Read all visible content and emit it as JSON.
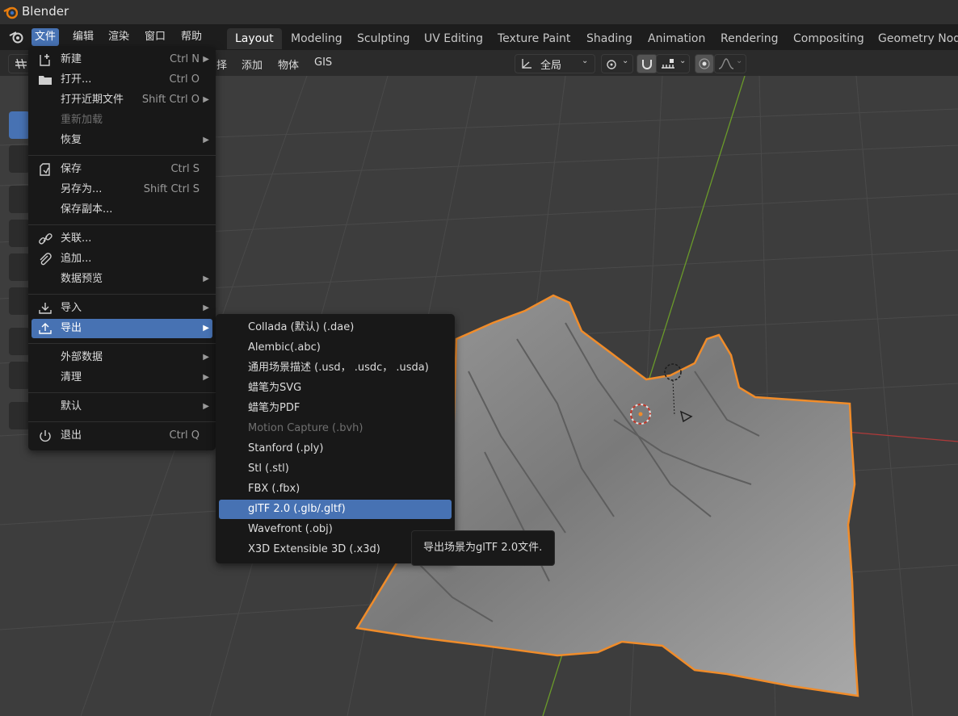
{
  "app": {
    "title": "Blender"
  },
  "topbar": {
    "menus": [
      "文件",
      "编辑",
      "渲染",
      "窗口",
      "帮助"
    ],
    "workspaces": [
      "Layout",
      "Modeling",
      "Sculpting",
      "UV Editing",
      "Texture Paint",
      "Shading",
      "Animation",
      "Rendering",
      "Compositing",
      "Geometry Node"
    ]
  },
  "header": {
    "menus": [
      "择",
      "添加",
      "物体",
      "GIS"
    ],
    "transform_orientation": "全局"
  },
  "file_menu": {
    "items": [
      {
        "label": "新建",
        "shortcut": "Ctrl N",
        "arrow": "▶",
        "icon": "new-file-icon"
      },
      {
        "label": "打开...",
        "shortcut": "Ctrl O",
        "icon": "folder-icon"
      },
      {
        "label": "打开近期文件",
        "shortcut": "Shift Ctrl O",
        "arrow": "▶"
      },
      {
        "label": "重新加载",
        "disabled": true
      },
      {
        "label": "恢复",
        "arrow": "▶"
      },
      {
        "label": "保存",
        "shortcut": "Ctrl S",
        "icon": "save-icon"
      },
      {
        "label": "另存为...",
        "shortcut": "Shift Ctrl S"
      },
      {
        "label": "保存副本..."
      },
      {
        "label": "关联...",
        "icon": "link-icon"
      },
      {
        "label": "追加...",
        "icon": "append-icon"
      },
      {
        "label": "数据预览",
        "arrow": "▶"
      },
      {
        "label": "导入",
        "arrow": "▶",
        "icon": "import-icon"
      },
      {
        "label": "导出",
        "arrow": "▶",
        "icon": "export-icon",
        "highlighted": true
      },
      {
        "label": "外部数据",
        "arrow": "▶"
      },
      {
        "label": "清理",
        "arrow": "▶"
      },
      {
        "label": "默认",
        "arrow": "▶"
      },
      {
        "label": "退出",
        "shortcut": "Ctrl Q",
        "icon": "power-icon"
      }
    ]
  },
  "export_menu": {
    "items": [
      {
        "label": "Collada (默认) (.dae)"
      },
      {
        "label": "Alembic(.abc)"
      },
      {
        "label": "通用场景描述 (.usd， .usdc， .usda)"
      },
      {
        "label": "蜡笔为SVG"
      },
      {
        "label": "蜡笔为PDF"
      },
      {
        "label": "Motion Capture (.bvh)",
        "disabled": true
      },
      {
        "label": "Stanford (.ply)"
      },
      {
        "label": "Stl (.stl)"
      },
      {
        "label": "FBX (.fbx)"
      },
      {
        "label": "glTF 2.0 (.glb/.gltf)",
        "highlighted": true
      },
      {
        "label": "Wavefront (.obj)"
      },
      {
        "label": "X3D Extensible 3D (.x3d)"
      }
    ]
  },
  "tooltip": {
    "text": "导出场景为glTF 2.0文件."
  },
  "colors": {
    "accent": "#4772b3",
    "selection_outline": "#f08c2a",
    "x_axis": "#b03a3a",
    "y_axis": "#6a9a2a"
  }
}
